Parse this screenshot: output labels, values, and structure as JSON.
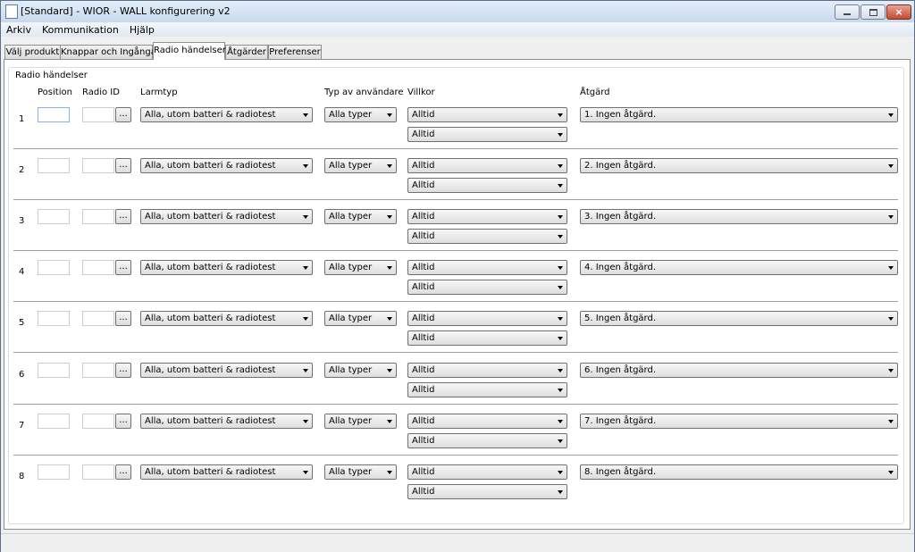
{
  "window": {
    "title": "[Standard] - WIOR - WALL konfigurering v2",
    "controls": {
      "minimize": "minimize",
      "maximize": "maximize",
      "close": "×"
    }
  },
  "menu": [
    "Arkiv",
    "Kommunikation",
    "Hjälp"
  ],
  "tabs": [
    {
      "label": "Välj produkt",
      "active": false
    },
    {
      "label": "Knappar och Ingångar",
      "active": false
    },
    {
      "label": "Radio händelser",
      "active": true
    },
    {
      "label": "Åtgärder",
      "active": false
    },
    {
      "label": "Preferenser",
      "active": false
    }
  ],
  "group": {
    "title": "Radio händelser",
    "headers": {
      "position": "Position",
      "radio_id": "Radio ID",
      "larmtyp": "Larmtyp",
      "typ": "Typ av användare",
      "villkor": "Villkor",
      "atgard": "Åtgärd"
    },
    "browse_label": "...",
    "rows": [
      {
        "num": "1",
        "position": "",
        "radio_id": "",
        "larmtyp": "Alla, utom batteri & radiotest",
        "typ": "Alla typer",
        "villkor1": "Alltid",
        "villkor2": "Alltid",
        "atgard": "1. Ingen åtgärd."
      },
      {
        "num": "2",
        "position": "",
        "radio_id": "",
        "larmtyp": "Alla, utom batteri & radiotest",
        "typ": "Alla typer",
        "villkor1": "Alltid",
        "villkor2": "Alltid",
        "atgard": "2. Ingen åtgärd."
      },
      {
        "num": "3",
        "position": "",
        "radio_id": "",
        "larmtyp": "Alla, utom batteri & radiotest",
        "typ": "Alla typer",
        "villkor1": "Alltid",
        "villkor2": "Alltid",
        "atgard": "3. Ingen åtgärd."
      },
      {
        "num": "4",
        "position": "",
        "radio_id": "",
        "larmtyp": "Alla, utom batteri & radiotest",
        "typ": "Alla typer",
        "villkor1": "Alltid",
        "villkor2": "Alltid",
        "atgard": "4. Ingen åtgärd."
      },
      {
        "num": "5",
        "position": "",
        "radio_id": "",
        "larmtyp": "Alla, utom batteri & radiotest",
        "typ": "Alla typer",
        "villkor1": "Alltid",
        "villkor2": "Alltid",
        "atgard": "5. Ingen åtgärd."
      },
      {
        "num": "6",
        "position": "",
        "radio_id": "",
        "larmtyp": "Alla, utom batteri & radiotest",
        "typ": "Alla typer",
        "villkor1": "Alltid",
        "villkor2": "Alltid",
        "atgard": "6. Ingen åtgärd."
      },
      {
        "num": "7",
        "position": "",
        "radio_id": "",
        "larmtyp": "Alla, utom batteri & radiotest",
        "typ": "Alla typer",
        "villkor1": "Alltid",
        "villkor2": "Alltid",
        "atgard": "7. Ingen åtgärd."
      },
      {
        "num": "8",
        "position": "",
        "radio_id": "",
        "larmtyp": "Alla, utom batteri & radiotest",
        "typ": "Alla typer",
        "villkor1": "Alltid",
        "villkor2": "Alltid",
        "atgard": "8. Ingen åtgärd."
      }
    ]
  },
  "statusbar": {
    "text": ""
  }
}
